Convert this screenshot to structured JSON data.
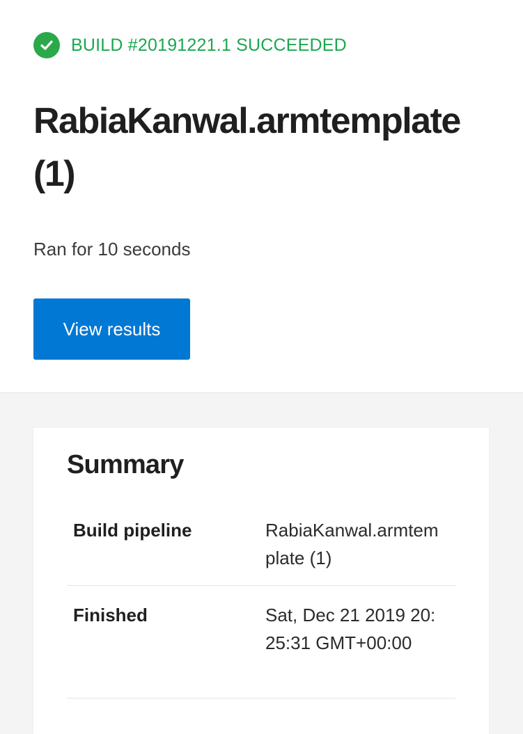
{
  "header": {
    "status_icon": "check-circle-icon",
    "status_color": "#2ba84a",
    "status_text": "BUILD #20191221.1 SUCCEEDED",
    "title": "RabiaKanwal.armtemplate (1)",
    "duration": "Ran for 10 seconds",
    "view_results_label": "View results",
    "accent_color": "#0078d4"
  },
  "summary": {
    "title": "Summary",
    "rows": [
      {
        "label": "Build pipeline",
        "value": "RabiaKanwal.armtemplate (1)"
      },
      {
        "label": "Finished",
        "value": "Sat, Dec 21 2019 20:25:31 GMT+00:00"
      }
    ]
  }
}
